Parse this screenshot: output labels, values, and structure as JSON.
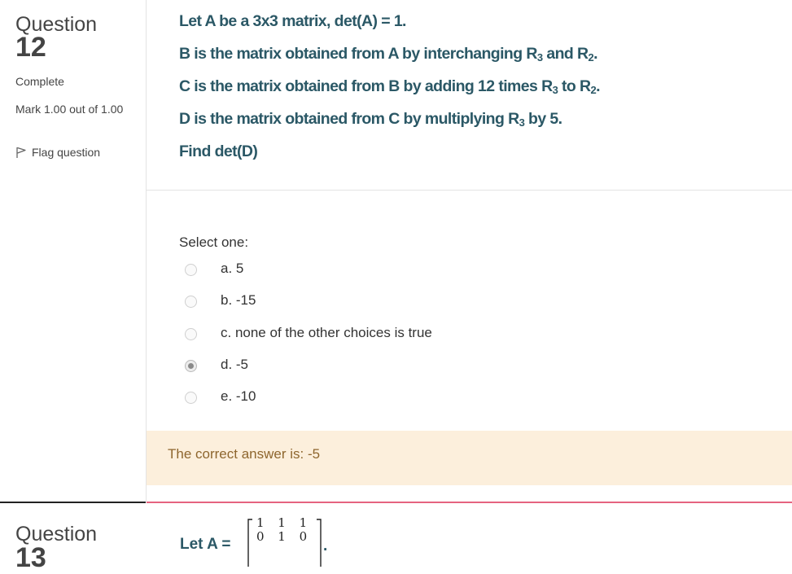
{
  "question": {
    "label": "Question",
    "number": "12",
    "state": "Complete",
    "mark": "Mark 1.00 out of 1.00",
    "flag_label": "Flag question",
    "lines": [
      {
        "pre": "Let A be a 3x3 matrix, det(A) = 1."
      },
      {
        "pre": "B is the matrix obtained from A by interchanging R",
        "s1": "3",
        "mid": " and R",
        "s2": "2",
        "post": "."
      },
      {
        "pre": "C is the matrix obtained from B by adding 12 times R",
        "s1": "3",
        "mid": " to R",
        "s2": "2",
        "post": "."
      },
      {
        "pre": "D is the matrix obtained from C by multiplying R",
        "s1": "3",
        "mid": " by 5."
      },
      {
        "pre": "Find det(D)"
      }
    ]
  },
  "answer": {
    "prompt": "Select one:",
    "options": [
      {
        "label": "a. 5",
        "selected": false
      },
      {
        "label": "b. -15",
        "selected": false
      },
      {
        "label": "c. none of the other choices is true",
        "selected": false
      },
      {
        "label": "d. -5",
        "selected": true
      },
      {
        "label": "e. -10",
        "selected": false
      }
    ]
  },
  "feedback": {
    "text": "The correct answer is: -5"
  },
  "next_question": {
    "label": "Question",
    "number": "13",
    "text": "Let A =",
    "matrix_rows": [
      "1 1 1",
      "0 1 0"
    ],
    "trailing": "."
  },
  "colors": {
    "question_text": "#2b5866",
    "feedback_bg": "#fcefdc",
    "feedback_text": "#8e662e",
    "divider_active": "#e5637f"
  }
}
